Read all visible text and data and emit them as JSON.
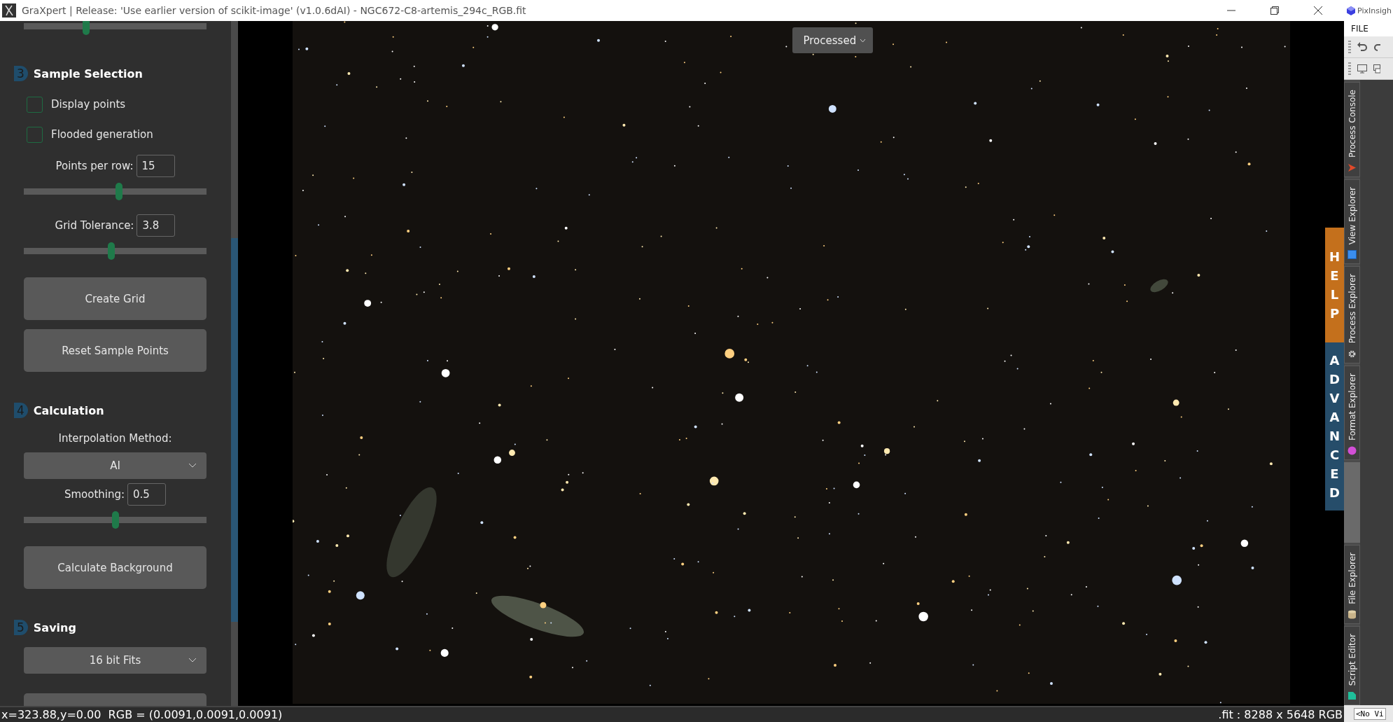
{
  "window": {
    "title": "GraXpert | Release: 'Use earlier version of scikit-image' (v1.0.6dAI) - NGC672-C8-artemis_294c_RGB.fit"
  },
  "sidebar": {
    "top_slider": {
      "level": 0.34
    },
    "sections": [
      {
        "number": "3",
        "title": "Sample Selection",
        "items": [
          {
            "kind": "checkbox",
            "label": "Display points",
            "checked": false
          },
          {
            "kind": "checkbox",
            "label": "Flooded generation",
            "checked": false
          },
          {
            "kind": "number",
            "label": "Points per row:",
            "value": "15",
            "level": 0.52
          },
          {
            "kind": "number",
            "label": "Grid Tolerance:",
            "value": "3.8",
            "level": 0.48
          },
          {
            "kind": "button",
            "label": "Create Grid"
          },
          {
            "kind": "button",
            "label": "Reset Sample Points"
          }
        ]
      },
      {
        "number": "4",
        "title": "Calculation",
        "items": [
          {
            "kind": "label",
            "label": "Interpolation Method:"
          },
          {
            "kind": "dropdown",
            "value": "AI"
          },
          {
            "kind": "number",
            "label": "Smoothing:",
            "value": "0.5",
            "level": 0.5
          },
          {
            "kind": "button",
            "label": "Calculate Background"
          }
        ]
      },
      {
        "number": "5",
        "title": "Saving",
        "items": [
          {
            "kind": "dropdown",
            "value": "16 bit Fits"
          },
          {
            "kind": "button"
          }
        ]
      }
    ]
  },
  "viewer": {
    "display_menu": "Processed",
    "side_tabs": [
      {
        "label": "HELP",
        "color": "#c4701c"
      },
      {
        "label": "ADVANCED",
        "color": "#264d6a"
      }
    ]
  },
  "status_bar": {
    "position": "x=323.88,y=0.00  RGB = (0.0091,0.0091,0.0091)",
    "image_info": ".fit : 8288 x 5648 RGB"
  },
  "pixinsight": {
    "title": "PixInsigh",
    "menu": "FILE",
    "dock_tabs": [
      {
        "label": "Process Console"
      },
      {
        "label": "View Explorer"
      },
      {
        "label": "Process Explorer"
      },
      {
        "label": "Format Explorer"
      },
      {
        "label": "File Explorer"
      },
      {
        "label": "Script Editor"
      }
    ],
    "view_field": "<No Vi"
  }
}
